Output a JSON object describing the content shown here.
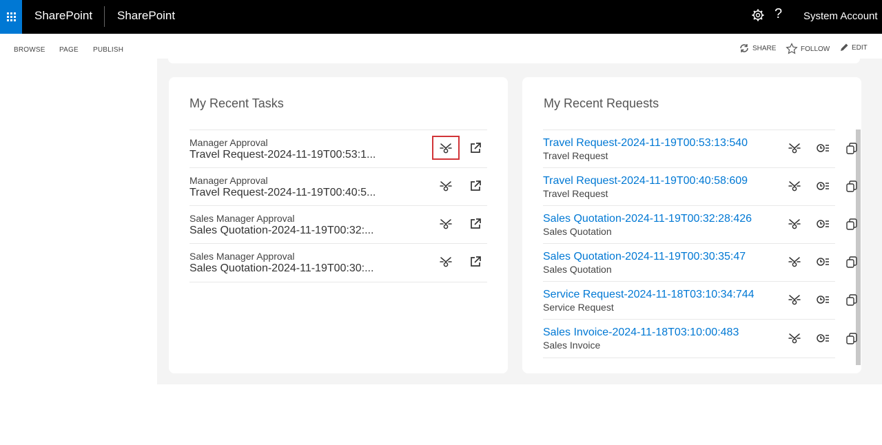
{
  "suitebar": {
    "brand": "SharePoint",
    "site_title": "SharePoint",
    "account": "System Account",
    "help_glyph": "?"
  },
  "ribbon": {
    "tabs": [
      "BROWSE",
      "PAGE",
      "PUBLISH"
    ],
    "share": "SHARE",
    "follow": "FOLLOW",
    "edit": "EDIT"
  },
  "tasks": {
    "title": "My Recent Tasks",
    "items": [
      {
        "step": "Manager Approval",
        "name": "Travel Request-2024-11-19T00:53:1..."
      },
      {
        "step": "Manager Approval",
        "name": "Travel Request-2024-11-19T00:40:5..."
      },
      {
        "step": "Sales Manager Approval",
        "name": "Sales Quotation-2024-11-19T00:32:..."
      },
      {
        "step": "Sales Manager Approval",
        "name": "Sales Quotation-2024-11-19T00:30:..."
      }
    ]
  },
  "requests": {
    "title": "My Recent Requests",
    "items": [
      {
        "name": "Travel Request-2024-11-19T00:53:13:540",
        "type": "Travel Request"
      },
      {
        "name": "Travel Request-2024-11-19T00:40:58:609",
        "type": "Travel Request"
      },
      {
        "name": "Sales Quotation-2024-11-19T00:32:28:426",
        "type": "Sales Quotation"
      },
      {
        "name": "Sales Quotation-2024-11-19T00:30:35:47",
        "type": "Sales Quotation"
      },
      {
        "name": "Service Request-2024-11-18T03:10:34:744",
        "type": "Service Request"
      },
      {
        "name": "Sales Invoice-2024-11-18T03:10:00:483",
        "type": "Sales Invoice"
      }
    ]
  },
  "icons": {
    "waffle": "app-launcher-icon",
    "settings": "gear-icon",
    "share": "share-icon",
    "follow": "star-icon",
    "edit": "pencil-icon",
    "task_view": "workflow-view-icon",
    "task_open": "open-external-icon",
    "req_view": "workflow-view-icon",
    "req_history": "history-icon",
    "req_copy": "copy-icon"
  },
  "colors": {
    "suitebar": "#000000",
    "accent": "#0078d4",
    "highlight": "#d13438"
  }
}
